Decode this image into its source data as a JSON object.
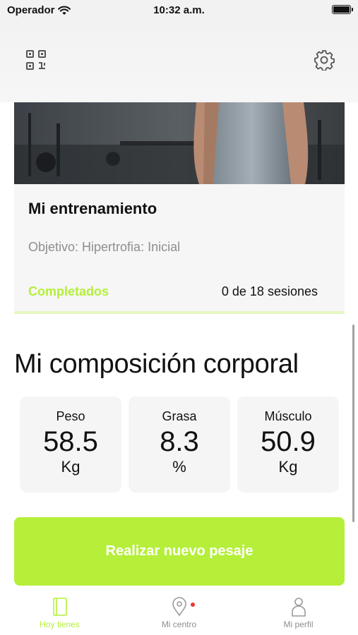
{
  "status_bar": {
    "carrier": "Operador",
    "time": "10:32 a.m."
  },
  "header": {
    "left_icon": "qr-code-icon",
    "right_icon": "gear-icon"
  },
  "training_card": {
    "title": "Mi entrenamiento",
    "subtitle": "Objetivo: Hipertrofia: Inicial",
    "progress_label": "Completados",
    "progress_value": "0 de 18 sesiones",
    "progress_fraction": 0
  },
  "body_composition": {
    "title": "Mi composición corporal",
    "metrics": [
      {
        "label": "Peso",
        "value": "58.5",
        "unit": "Kg"
      },
      {
        "label": "Grasa",
        "value": "8.3",
        "unit": "%"
      },
      {
        "label": "Músculo",
        "value": "50.9",
        "unit": "Kg"
      }
    ]
  },
  "action_button": {
    "label": "Realizar nuevo pesaje"
  },
  "tabbar": {
    "tabs": [
      {
        "label": "Hoy tienes",
        "icon": "notebook-icon",
        "active": true
      },
      {
        "label": "Mi centro",
        "icon": "location-pin-icon",
        "badge": true
      },
      {
        "label": "Mi perfil",
        "icon": "person-icon"
      }
    ]
  },
  "colors": {
    "accent": "#b5ef3a",
    "muted_text": "#8e8e8e",
    "badge": "#e53935"
  }
}
